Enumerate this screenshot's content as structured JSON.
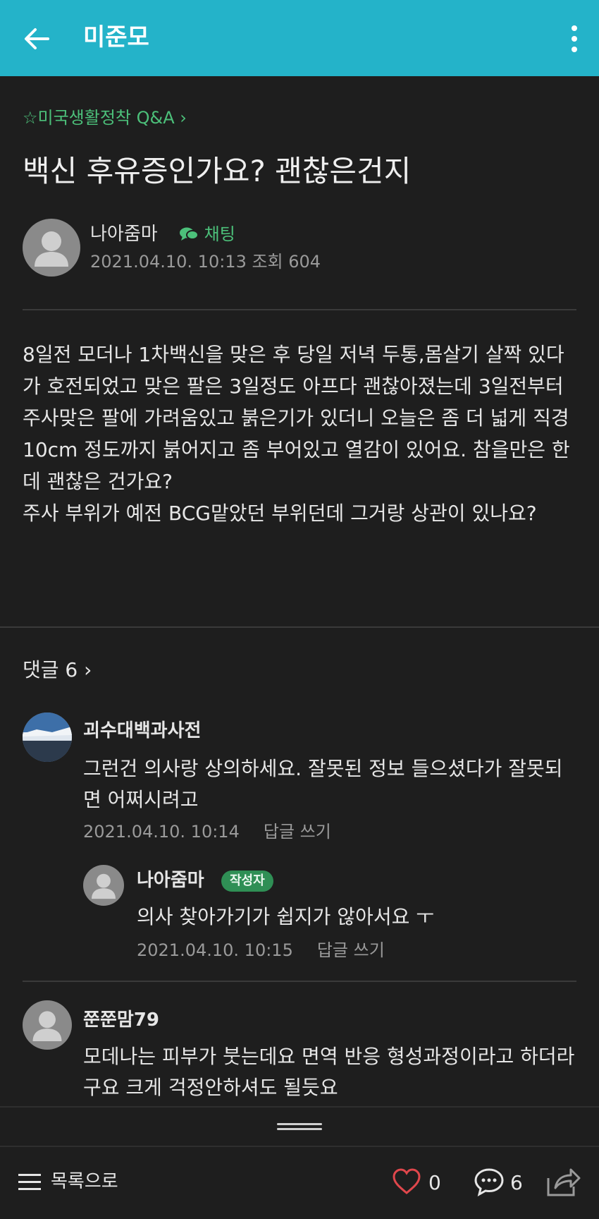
{
  "appbar": {
    "title": "미준모",
    "back_icon": "arrow-left-icon",
    "more_icon": "more-vertical-icon"
  },
  "post": {
    "breadcrumb": "☆미국생활정착 Q&A ›",
    "title": "백신 후유증인가요? 괜찮은건지",
    "author": "나아줌마",
    "chat_label": "채팅",
    "meta": "2021.04.10. 10:13  조회 604",
    "body": "8일전 모더나 1차백신을 맞은 후 당일 저녁 두통,몸살기 살짝 있다가 호전되었고 맞은 팔은 3일정도 아프다 괜찮아졌는데 3일전부터 주사맞은 팔에 가려움있고 붉은기가 있더니 오늘은 좀 더 넓게 직경 10cm 정도까지 붉어지고 좀 부어있고 열감이 있어요. 참을만은 한데 괜찮은 건가요?\n주사 부위가 예전 BCG맡았던 부위던데 그거랑 상관이 있나요?"
  },
  "comments": {
    "header": "댓글 6 ›",
    "items": [
      {
        "name": "괴수대백과사전",
        "text": "그런건 의사랑 상의하세요. 잘못된 정보 들으셨다가 잘못되면 어쩌시려고",
        "date": "2021.04.10. 10:14",
        "reply_label": "답글 쓰기"
      },
      {
        "name": "나아줌마",
        "badge": "작성자",
        "text": "의사 찾아가기가 쉽지가 않아서요 ㅜ",
        "date": "2021.04.10. 10:15",
        "reply_label": "답글 쓰기"
      },
      {
        "name": "쭌쭌맘79",
        "text": "모데나는 피부가 붓는데요 면역 반응 형성과정이라고 하더라구요 크게 걱정안하셔도 될듯요"
      }
    ]
  },
  "bottombar": {
    "list_label": "목록으로",
    "like_count": "0",
    "comment_count": "6"
  },
  "colors": {
    "appbar": "#24b3c9",
    "accent_green": "#4cc07a",
    "background": "#1e1e1e",
    "heart": "#e0474c"
  }
}
